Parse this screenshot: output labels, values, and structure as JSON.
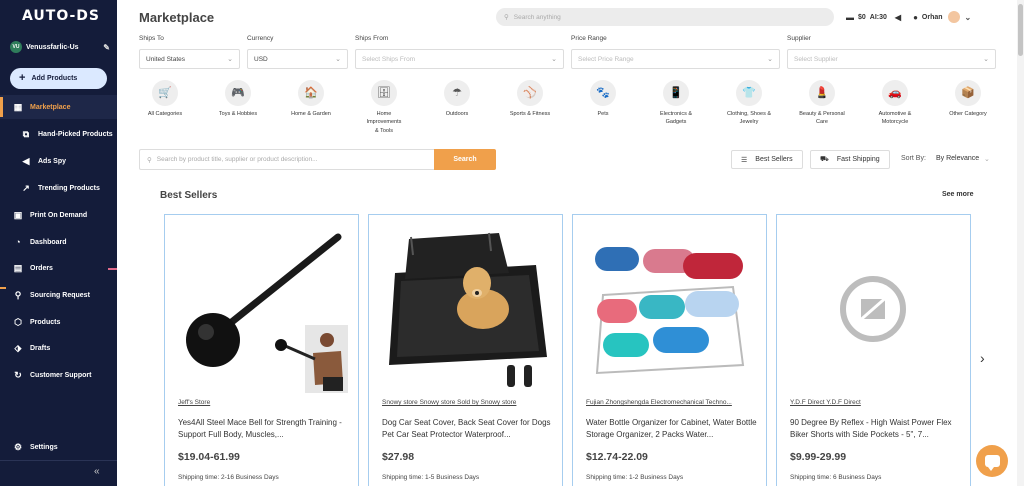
{
  "app": {
    "logo": "AUTO-DS"
  },
  "account": {
    "initials": "VU",
    "name": "Venussfarlic-Us"
  },
  "sidebar": {
    "add_products": "Add Products",
    "items": [
      {
        "label": "Marketplace",
        "icon": "store-icon"
      },
      {
        "label": "Hand-Picked Products",
        "icon": "box-star-icon"
      },
      {
        "label": "Ads Spy",
        "icon": "megaphone-icon"
      },
      {
        "label": "Trending Products",
        "icon": "trend-icon"
      },
      {
        "label": "Print On Demand",
        "icon": "shirt-icon"
      },
      {
        "label": "Dashboard",
        "icon": "gauge-icon"
      },
      {
        "label": "Orders",
        "icon": "clipboard-icon"
      },
      {
        "label": "Sourcing Request",
        "icon": "cart-search-icon"
      },
      {
        "label": "Products",
        "icon": "box-icon"
      },
      {
        "label": "Drafts",
        "icon": "drafts-icon"
      },
      {
        "label": "Customer Support",
        "icon": "headset-icon"
      }
    ],
    "settings": "Settings",
    "collapse": "«"
  },
  "header": {
    "title": "Marketplace",
    "search_placeholder": "Search anything",
    "credits_label": "$0",
    "ai_label": "AI:30",
    "user_name": "Orhan"
  },
  "filters": [
    {
      "label": "Ships To",
      "value": "United States",
      "placeholder": ""
    },
    {
      "label": "Currency",
      "value": "USD",
      "placeholder": ""
    },
    {
      "label": "Ships From",
      "value": "",
      "placeholder": "Select Ships From"
    },
    {
      "label": "Price Range",
      "value": "",
      "placeholder": "Select Price Range"
    },
    {
      "label": "Supplier",
      "value": "",
      "placeholder": "Select Supplier"
    }
  ],
  "categories": [
    {
      "label": "All Categories",
      "glyph": "🛒"
    },
    {
      "label": "Toys & Hobbies",
      "glyph": "🎮"
    },
    {
      "label": "Home & Garden",
      "glyph": "🏠"
    },
    {
      "label": "Home Improvements & Tools",
      "glyph": "🗄"
    },
    {
      "label": "Outdoors",
      "glyph": "☂"
    },
    {
      "label": "Sports & Fitness",
      "glyph": "⚾"
    },
    {
      "label": "Pets",
      "glyph": "🐾"
    },
    {
      "label": "Electronics & Gadgets",
      "glyph": "📱"
    },
    {
      "label": "Clothing, Shoes & Jewelry",
      "glyph": "👕"
    },
    {
      "label": "Beauty & Personal Care",
      "glyph": "💄"
    },
    {
      "label": "Automotive & Motorcycle",
      "glyph": "🚗"
    },
    {
      "label": "Other Category",
      "glyph": "📦"
    }
  ],
  "search": {
    "placeholder": "Search by product title, supplier or product description...",
    "button": "Search",
    "best_sellers": "Best Sellers",
    "fast_shipping": "Fast Shipping",
    "sort_by_label": "Sort By:",
    "sort_by_value": "By Relevance"
  },
  "section": {
    "title": "Best Sellers",
    "see_more": "See more"
  },
  "products": [
    {
      "supplier": "Jeff's Store",
      "title": "Yes4All Steel Mace Bell for Strength Training - Support Full Body, Muscles,...",
      "price": "$19.04-61.99",
      "shipping": "Shipping time: 2-16 Business Days"
    },
    {
      "supplier": "Snowy store Snowy store Sold by Snowy store",
      "title": "Dog Car Seat Cover, Back Seat Cover for Dogs Pet Car Seat Protector Waterproof...",
      "price": "$27.98",
      "shipping": "Shipping time: 1-5 Business Days"
    },
    {
      "supplier": "Fujian Zhongshengda Electromechanical Techno...",
      "title": "Water Bottle Organizer for Cabinet, Water Bottle Storage Organizer, 2 Packs Water...",
      "price": "$12.74-22.09",
      "shipping": "Shipping time: 1-2 Business Days"
    },
    {
      "supplier": "Y.D.F Direct Y.D.F Direct",
      "title": "90 Degree By Reflex - High Waist Power Flex Biker Shorts with Side Pockets - 5\", 7...",
      "price": "$9.99-29.99",
      "shipping": "Shipping time: 6 Business Days"
    }
  ]
}
